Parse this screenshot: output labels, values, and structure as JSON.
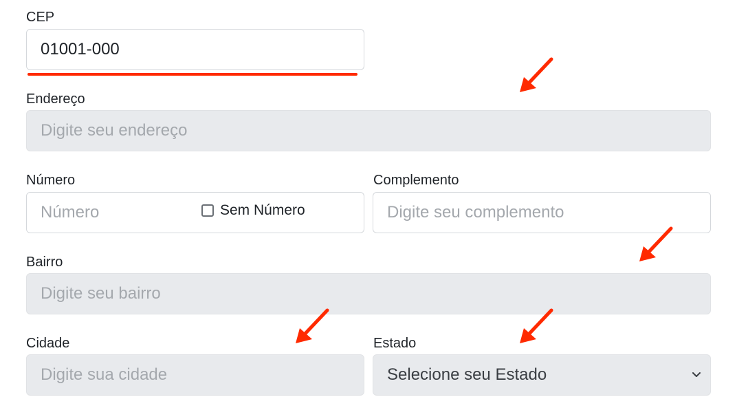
{
  "form": {
    "cep": {
      "label": "CEP",
      "value": "01001-000"
    },
    "endereco": {
      "label": "Endereço",
      "placeholder": "Digite seu endereço"
    },
    "numero": {
      "label": "Número",
      "placeholder": "Número",
      "checkbox_label": "Sem Número",
      "checkbox_checked": false
    },
    "complemento": {
      "label": "Complemento",
      "placeholder": "Digite seu complemento"
    },
    "bairro": {
      "label": "Bairro",
      "placeholder": "Digite seu bairro"
    },
    "cidade": {
      "label": "Cidade",
      "placeholder": "Digite sua cidade"
    },
    "estado": {
      "label": "Estado",
      "selected": "Selecione seu Estado"
    }
  },
  "annotations": {
    "color": "#ff2a00",
    "arrows": [
      "red-arrow-icon",
      "red-arrow-icon",
      "red-arrow-icon",
      "red-arrow-icon"
    ],
    "underline": "cep-underline"
  },
  "colors": {
    "disabled_background": "#e8eaed",
    "border": "#d5d8dc",
    "placeholder": "#a4a8ad"
  }
}
